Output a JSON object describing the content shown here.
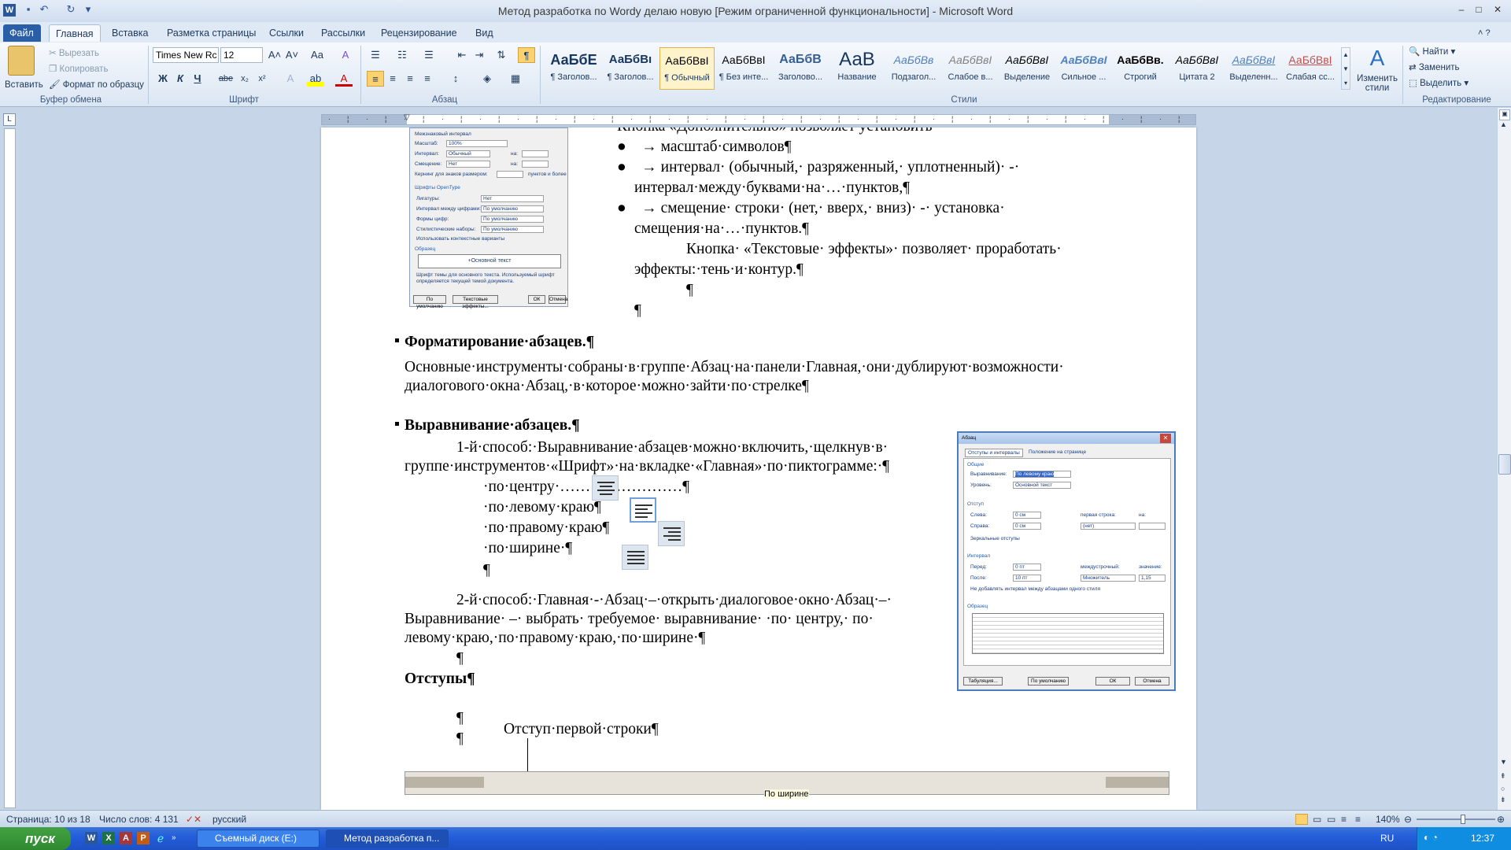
{
  "window": {
    "title": "Метод разработка по Wordy делаю новую [Режим ограниченной функциональности]  -  Microsoft Word",
    "minimize": "–",
    "maximize": "□",
    "close": "✕"
  },
  "tabs": [
    "Файл",
    "Главная",
    "Вставка",
    "Разметка страницы",
    "Ссылки",
    "Рассылки",
    "Рецензирование",
    "Вид"
  ],
  "ribbon": {
    "clipboard": {
      "paste": "Вставить",
      "cut": "Вырезать",
      "copy": "Копировать",
      "format_painter": "Формат по образцу",
      "label": "Буфер обмена"
    },
    "font": {
      "name": "Times New Rc",
      "size": "12",
      "bold": "Ж",
      "italic": "К",
      "underline": "Ч",
      "strike": "abe",
      "sub": "x₂",
      "sup": "x²",
      "grow": "A˄",
      "shrink": "A˅",
      "case": "Aa",
      "clear": "A",
      "label": "Шрифт"
    },
    "paragraph": {
      "label": "Абзац"
    },
    "styles": {
      "label": "Стили",
      "items": [
        {
          "preview": "АаБбЕ",
          "name": "¶ Заголов..."
        },
        {
          "preview": "АаБбВı",
          "name": "¶ Заголов..."
        },
        {
          "preview": "АаБбВвI",
          "name": "¶ Обычный"
        },
        {
          "preview": "АаБбВвI",
          "name": "¶ Без инте..."
        },
        {
          "preview": "АаБбВ",
          "name": "Заголово..."
        },
        {
          "preview": "АаВ",
          "name": "Название"
        },
        {
          "preview": "АаБбВв",
          "name": "Подзагол..."
        },
        {
          "preview": "АаБбВвI",
          "name": "Слабое в..."
        },
        {
          "preview": "АаБбВвI",
          "name": "Выделение"
        },
        {
          "preview": "АаБбВвI",
          "name": "Сильное ..."
        },
        {
          "preview": "АаБбВв.",
          "name": "Строгий"
        },
        {
          "preview": "АаБбВвI",
          "name": "Цитата 2"
        },
        {
          "preview": "АаБбВвI",
          "name": "Выделенн..."
        },
        {
          "preview": "АаБбВвI",
          "name": "Слабая сс..."
        }
      ],
      "change": "Изменить стили"
    },
    "editing": {
      "find": "Найти",
      "replace": "Заменить",
      "select": "Выделить",
      "label": "Редактирование"
    }
  },
  "document": {
    "top_line": "Кнопка «Дополнительно» позволяет установить",
    "bullet1": "→    масштаб·символов¶",
    "bullet2a": "→    интервал· (обычный,· разряженный,· уплотненный)· -·",
    "bullet2b": "интервал·между·буквами·на·…·пунктов,¶",
    "bullet3a": "→    смещение· строки· (нет,· вверх,· вниз)· -· установка·",
    "bullet3b": "смещения·на·…·пунктов.¶",
    "effects1": "Кнопка· «Текстовые· эффекты»· позволяет· проработать·",
    "effects2": "эффекты:·тень·и·контур.¶",
    "pilcrow": "¶",
    "h_format": "Форматирование·абзацев.¶",
    "p_format1": "Основные·инструменты·собраны·в·группе·Абзац·на·панели·Главная,·они·дублируют·возможности·",
    "p_format2": "диалогового·окна·Абзац,·в·которое·можно·зайти·по·стрелке¶",
    "h_align": "Выравнивание·абзацев.¶",
    "way1a": "1-й·способ:·Выравнивание·абзацев·можно·включить,·щелкнув·в·",
    "way1b": "группе·инструментов·«Шрифт»·на·вкладке·«Главная»·по·пиктограмме:·¶",
    "opt_center": "·по·центру·……………………¶",
    "opt_left": "·по·левому·краю¶",
    "opt_right": "·по·правому·краю¶",
    "opt_width": "·по·ширине·¶",
    "way2a": "2-й·способ:·Главная·-·Абзац·–·открыть·диалоговое·окно·Абзац·–·",
    "way2b": "Выравнивание· –· выбрать· требуемое· выравнивание· ·по· центру,· по·",
    "way2c": "левому·краю,·по·правому·краю,·по·ширине·¶",
    "h_indent": "Отступы¶",
    "first_indent": "Отступ·первой·строки¶",
    "ruler_label": "По ширине"
  },
  "dialog_font": {
    "title": "Межзнаковый интервал",
    "scale_label": "Масштаб:",
    "scale_val": "100%",
    "interval_label": "Интервал:",
    "interval_val": "Обычный",
    "offset_label": "Смещение:",
    "offset_val": "Нет",
    "kerning": "Кернинг для знаков размером:",
    "points": "пунктов и более",
    "by": "на:",
    "opentype": "Шрифты OpenType",
    "lig": "Лигатуры:",
    "lig_val": "Нет",
    "num_spacing": "Интервал между цифрами:",
    "num_spacing_val": "По умолчанию",
    "num_forms": "Формы цифр:",
    "num_forms_val": "По умолчанию",
    "stylistic": "Стилистические наборы:",
    "stylistic_val": "По умолчанию",
    "contextual": "Использовать контекстные варианты",
    "sample": "Образец",
    "sample_text": "+Основной текст",
    "note": "Шрифт темы для основного текста. Используемый шрифт определяется текущей темой документа.",
    "default_btn": "По умолчанию",
    "effects_btn": "Текстовые эффекты...",
    "ok": "ОК",
    "cancel": "Отмена"
  },
  "dialog_par": {
    "title": "Абзац",
    "tab1": "Отступы и интервалы",
    "tab2": "Положение на странице",
    "general": "Общие",
    "align_label": "Выравнивание:",
    "align_val": "По левому краю",
    "level_label": "Уровень:",
    "level_val": "Основной текст",
    "indent": "Отступ",
    "left_label": "Слева:",
    "left_val": "0 см",
    "right_label": "Справа:",
    "right_val": "0 см",
    "first_label": "первая строка:",
    "first_val": "(нет)",
    "by_label": "на:",
    "mirror": "Зеркальные отступы",
    "spacing": "Интервал",
    "before_label": "Перед:",
    "before_val": "0 пт",
    "after_label": "После:",
    "after_val": "10 пт",
    "line_label": "междустрочный:",
    "line_val": "Множитель",
    "value_label": "значение:",
    "value_val": "1,15",
    "no_space": "Не добавлять интервал между абзацами одного стиля",
    "sample": "Образец",
    "tabs_btn": "Табуляция...",
    "default_btn": "По умолчанию",
    "ok": "ОК",
    "cancel": "Отмена"
  },
  "statusbar": {
    "page": "Страница: 10 из 18",
    "words": "Число слов: 4 131",
    "lang": "русский",
    "zoom": "140%"
  },
  "taskbar": {
    "start": "пуск",
    "task1": "Съемный диск (E:)",
    "task2": "Метод разработка п...",
    "lang": "RU",
    "time": "12:37"
  }
}
